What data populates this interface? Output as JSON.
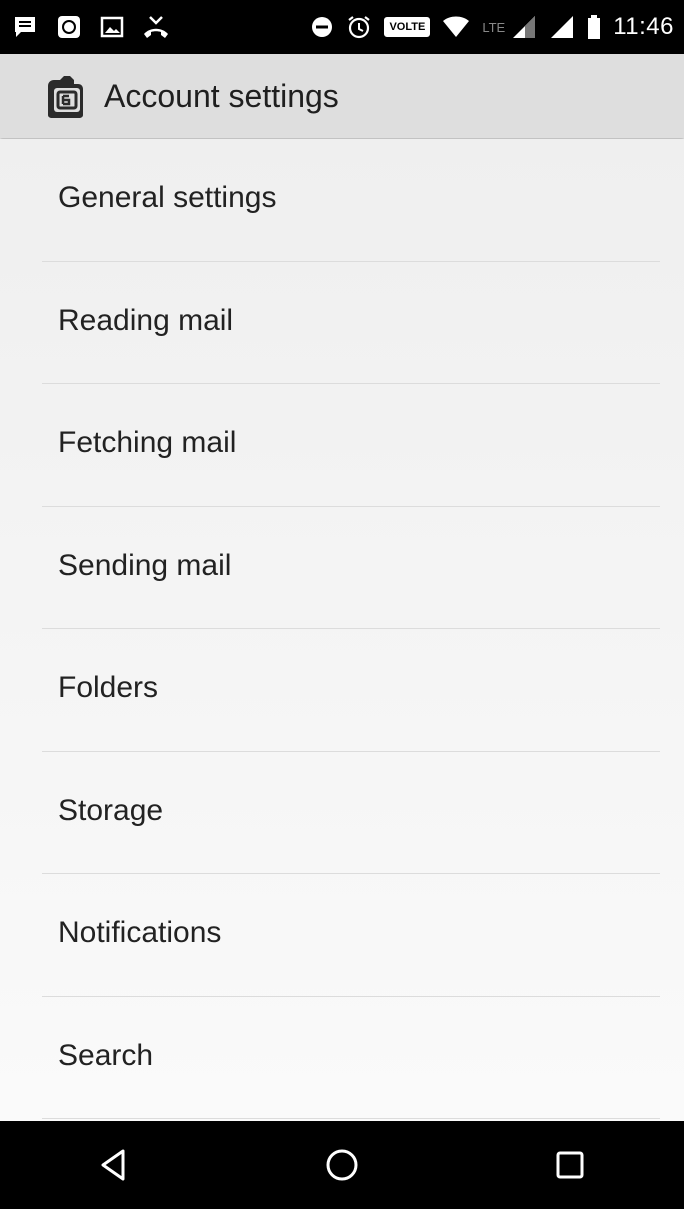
{
  "status_bar": {
    "time": "11:46",
    "volte": "VOLTE",
    "lte": "LTE",
    "icons_left": [
      "message-icon",
      "app-notification-icon",
      "image-icon",
      "missed-call-icon"
    ],
    "icons_right": [
      "do-not-disturb-icon",
      "alarm-icon",
      "volte-icon",
      "wifi-icon",
      "signal-icon",
      "signal-icon",
      "battery-icon"
    ]
  },
  "action_bar": {
    "title": "Account settings",
    "icon": "email-app-icon"
  },
  "settings": {
    "items": [
      {
        "label": "General settings"
      },
      {
        "label": "Reading mail"
      },
      {
        "label": "Fetching mail"
      },
      {
        "label": "Sending mail"
      },
      {
        "label": "Folders"
      },
      {
        "label": "Storage"
      },
      {
        "label": "Notifications"
      },
      {
        "label": "Search"
      }
    ]
  },
  "nav_bar": {
    "buttons": [
      "back-icon",
      "home-icon",
      "recents-icon"
    ]
  },
  "colors": {
    "status_bar": "#000000",
    "action_bar": "#dedede",
    "list_background": "#f5f5f5",
    "text": "#222222"
  }
}
